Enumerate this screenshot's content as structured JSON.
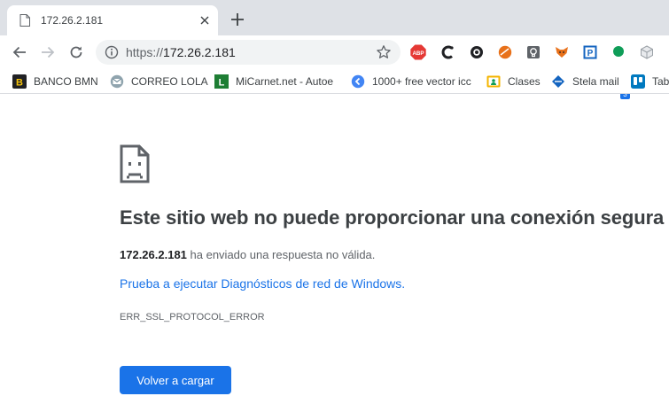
{
  "tab": {
    "title": "172.26.2.181"
  },
  "omnibox": {
    "scheme": "https://",
    "host": "172.26.2.181"
  },
  "extensions": [
    {
      "name": "adblock-plus-icon",
      "text": "ABP",
      "color": "#e53935"
    },
    {
      "name": "extension-c-icon",
      "text": "",
      "color": "#202124"
    },
    {
      "name": "extension-circle-icon",
      "text": "",
      "color": "#202124"
    },
    {
      "name": "extension-orange-icon",
      "text": "",
      "color": "#e8711a"
    },
    {
      "name": "extension-bulb-icon",
      "text": "",
      "color": "#5f6368"
    },
    {
      "name": "extension-fox-icon",
      "text": "",
      "color": "#e8711a"
    },
    {
      "name": "extension-p-icon",
      "text": "P",
      "color": "#1565c0"
    },
    {
      "name": "extension-green-dot-icon",
      "text": "",
      "color": "#0f9d58"
    },
    {
      "name": "extension-cube-icon",
      "text": "",
      "color": "#9aa0a6"
    }
  ],
  "extension_badge": "3",
  "bookmarks": [
    {
      "label": "BANCO BMN",
      "icon": "banco-bmn-icon"
    },
    {
      "label": "CORREO LOLA",
      "icon": "correo-icon"
    },
    {
      "label": "MiCarnet.net - Autoe",
      "icon": "micarnet-icon"
    },
    {
      "label": "1000+ free vector icc",
      "icon": "vector-icons-icon"
    },
    {
      "label": "Clases",
      "icon": "clases-icon"
    },
    {
      "label": "Stela mail",
      "icon": "stela-mail-icon"
    },
    {
      "label": "Tab",
      "icon": "trello-icon"
    }
  ],
  "error": {
    "heading": "Este sitio web no puede proporcionar una conexión segura",
    "host": "172.26.2.181",
    "summary_rest": " ha enviado una respuesta no válida.",
    "link": "Prueba a ejecutar Diagnósticos de red de Windows.",
    "code": "ERR_SSL_PROTOCOL_ERROR",
    "reload_label": "Volver a cargar"
  },
  "colors": {
    "accent": "#1a73e8",
    "tabstrip": "#dee1e6",
    "heading": "#3c4043"
  }
}
